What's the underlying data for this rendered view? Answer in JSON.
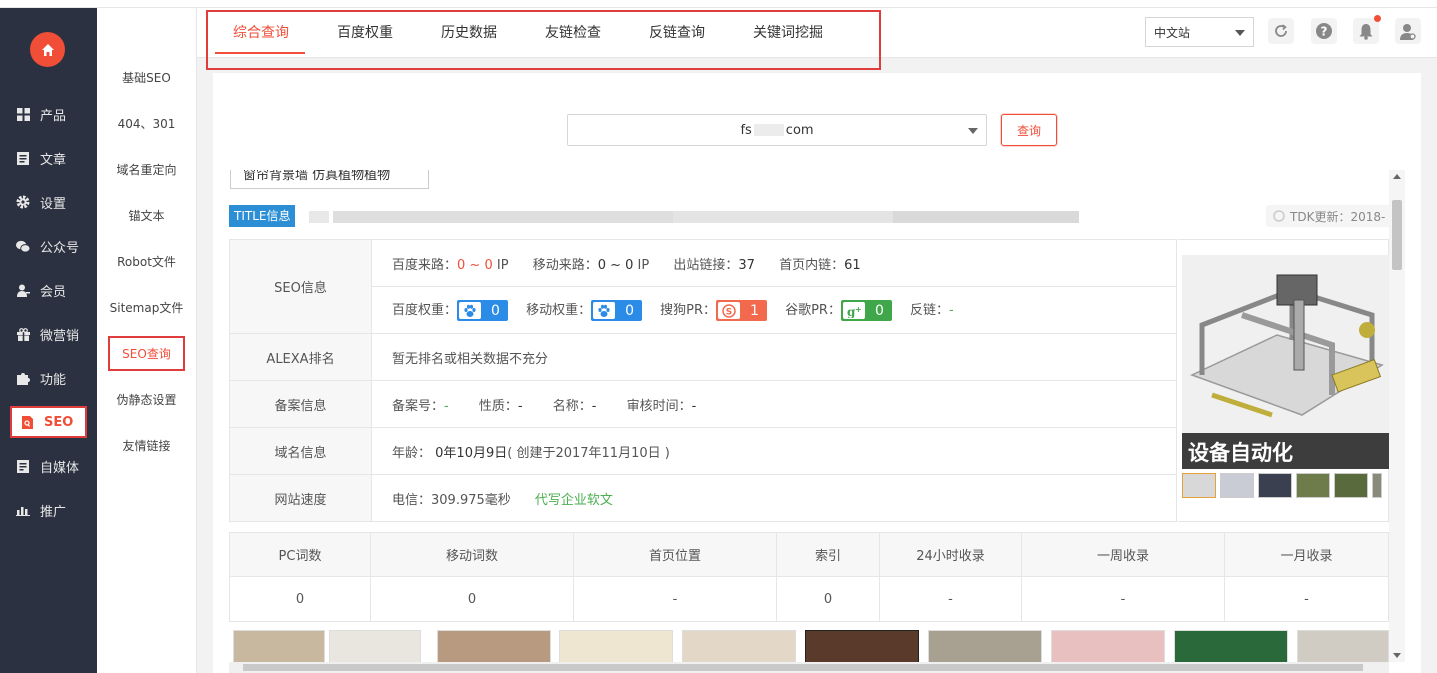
{
  "sidebar": {
    "items": [
      {
        "label": "产品",
        "icon": "grid-icon"
      },
      {
        "label": "文章",
        "icon": "document-icon"
      },
      {
        "label": "设置",
        "icon": "gear-icon"
      },
      {
        "label": "公众号",
        "icon": "wechat-icon"
      },
      {
        "label": "会员",
        "icon": "user-icon"
      },
      {
        "label": "微营销",
        "icon": "gift-icon"
      },
      {
        "label": "功能",
        "icon": "puzzle-icon"
      },
      {
        "label": "SEO",
        "icon": "seo-icon"
      },
      {
        "label": "自媒体",
        "icon": "media-icon"
      },
      {
        "label": "推广",
        "icon": "chart-icon"
      }
    ]
  },
  "submenu": {
    "items": [
      "基础SEO",
      "404、301",
      "域名重定向",
      "锚文本",
      "Robot文件",
      "Sitemap文件",
      "SEO查询",
      "伪静态设置",
      "友情链接"
    ]
  },
  "tabs": [
    "综合查询",
    "百度权重",
    "历史数据",
    "友链检查",
    "反链查询",
    "关键词挖掘"
  ],
  "header": {
    "lang": "中文站"
  },
  "query": {
    "domain_prefix": "fs",
    "domain_suffix": "com",
    "button": "查询"
  },
  "cut_text": "窗帘背景墙    仿真植物植物",
  "title_tag": "TITLE信息",
  "tdk": "TDK更新：2018-",
  "seo": {
    "label": "SEO信息",
    "baidu_source_label": "百度来路：",
    "baidu_source_value": "0 ~ 0",
    "mobile_source_label": "移动来路：",
    "mobile_source_value": "0 ~ 0",
    "ip": "IP",
    "outbound_label": "出站链接：",
    "outbound_value": "37",
    "inner_label": "首页内链：",
    "inner_value": "61",
    "baidu_weight_label": "百度权重：",
    "baidu_weight_value": "0",
    "mobile_weight_label": "移动权重：",
    "mobile_weight_value": "0",
    "sogou_label": "搜狗PR：",
    "sogou_value": "1",
    "google_label": "谷歌PR：",
    "google_value": "0",
    "backlink_label": "反链：",
    "backlink_value": "-"
  },
  "alexa": {
    "label": "ALEXA排名",
    "value": "暂无排名或相关数据不充分"
  },
  "icp": {
    "label": "备案信息",
    "no_label": "备案号：",
    "no_value": "-",
    "type_label": "性质：",
    "type_value": "-",
    "name_label": "名称：",
    "name_value": "-",
    "time_label": "审核时间：",
    "time_value": "-"
  },
  "domain": {
    "label": "域名信息",
    "age_label": "年龄：",
    "age_value": "0年10月9日",
    "created": "( 创建于2017年11月10日 )"
  },
  "speed": {
    "label": "网站速度",
    "value": "电信：309.975毫秒",
    "ad": "代写企业软文"
  },
  "image_caption": "设备自动化",
  "stats": {
    "headers": [
      "PC词数",
      "移动词数",
      "首页位置",
      "索引",
      "24小时收录",
      "一周收录",
      "一月收录"
    ],
    "values": [
      "0",
      "0",
      "-",
      "0",
      "-",
      "-",
      "-"
    ]
  },
  "colors": {
    "accent": "#f04e37",
    "sidebar": "#2b3140",
    "tag_blue": "#2c8fd6",
    "baidu_blue": "#2b8ce8",
    "sogou_red": "#f2694d",
    "google_green": "#3fa64a"
  }
}
